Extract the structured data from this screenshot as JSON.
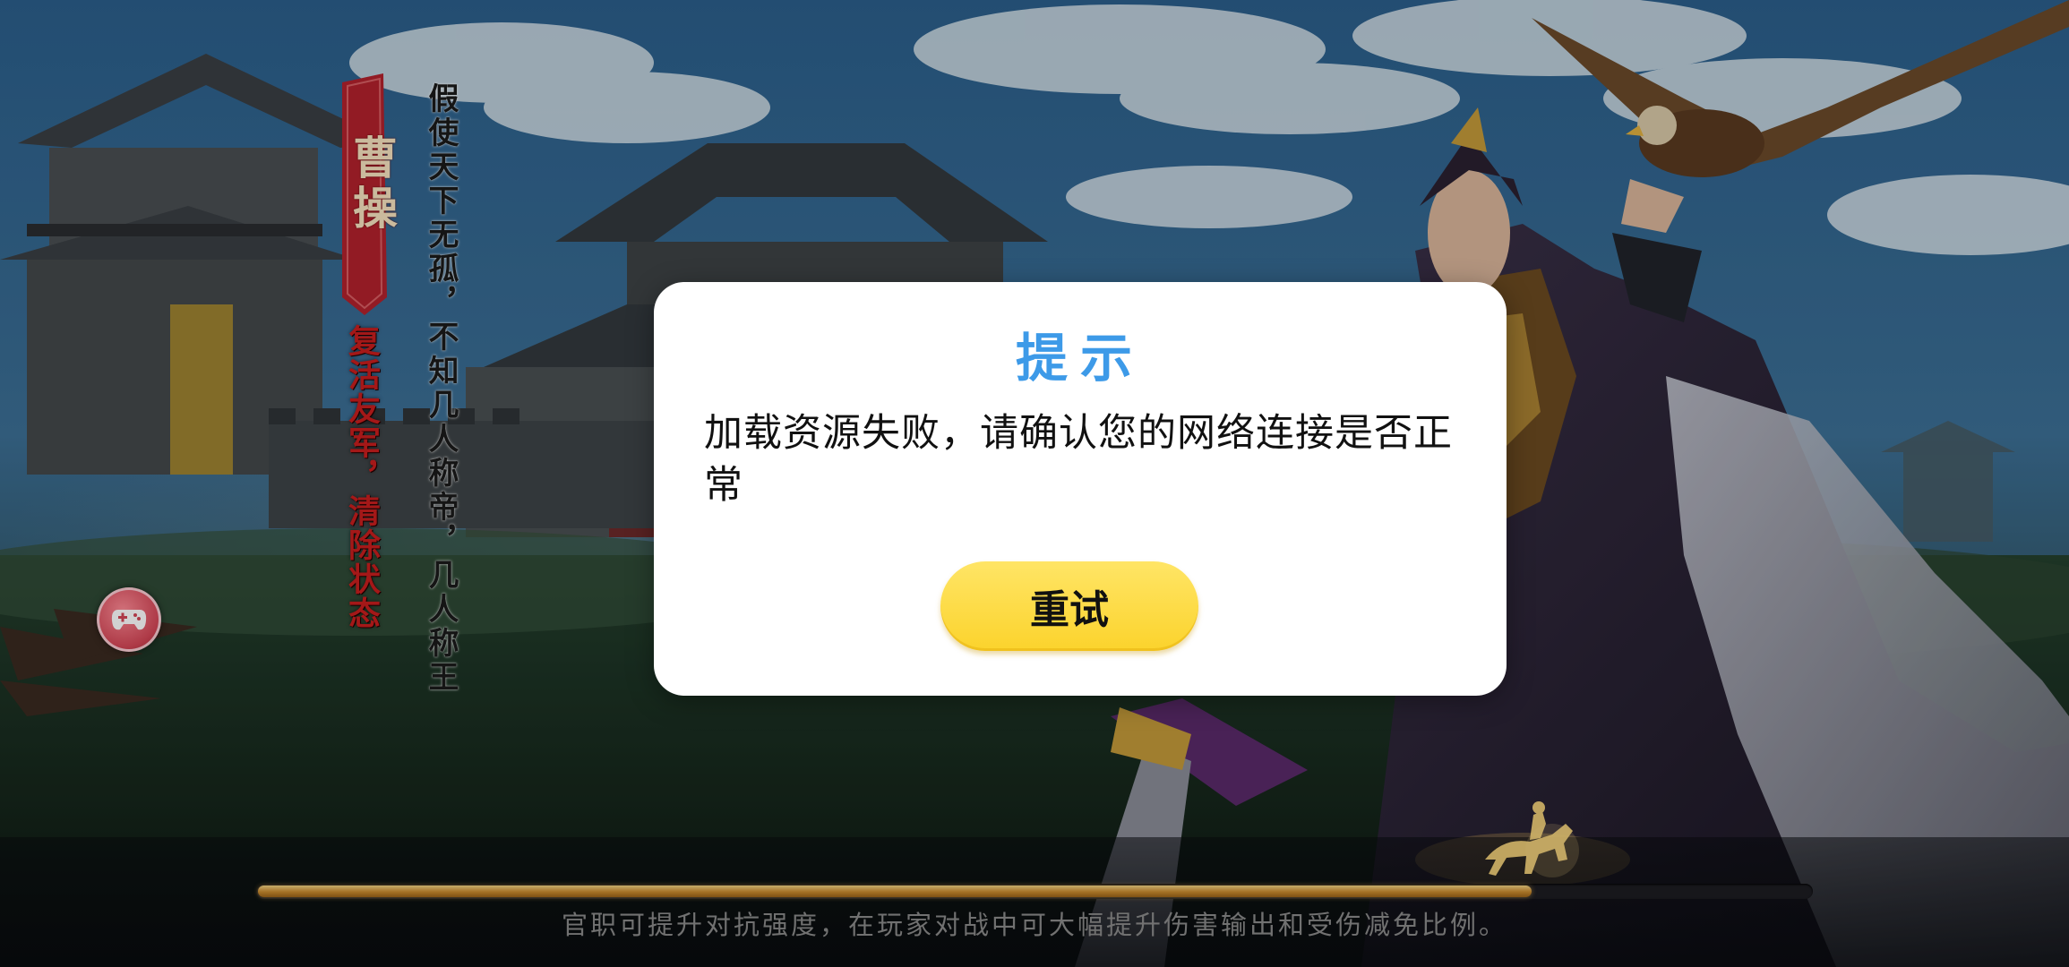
{
  "background": {
    "character_name": "曹操",
    "skill_text": "复活友军，清除状态",
    "poem_text": "假使天下无孤，不知几人称帝，几人称王"
  },
  "controls": {
    "gamepad_icon": "gamepad-icon"
  },
  "loading": {
    "progress": 0.82,
    "tip": "官职可提升对抗强度，在玩家对战中可大幅提升伤害输出和受伤减免比例。"
  },
  "dialog": {
    "title": "提示",
    "message": "加载资源失败，请确认您的网络连接是否正常",
    "retry_label": "重试"
  },
  "colors": {
    "title_blue": "#3d9ae8",
    "button_yellow": "#fbd32c",
    "skill_red": "#c81e1e",
    "progress_gold": "#c98a2e"
  }
}
